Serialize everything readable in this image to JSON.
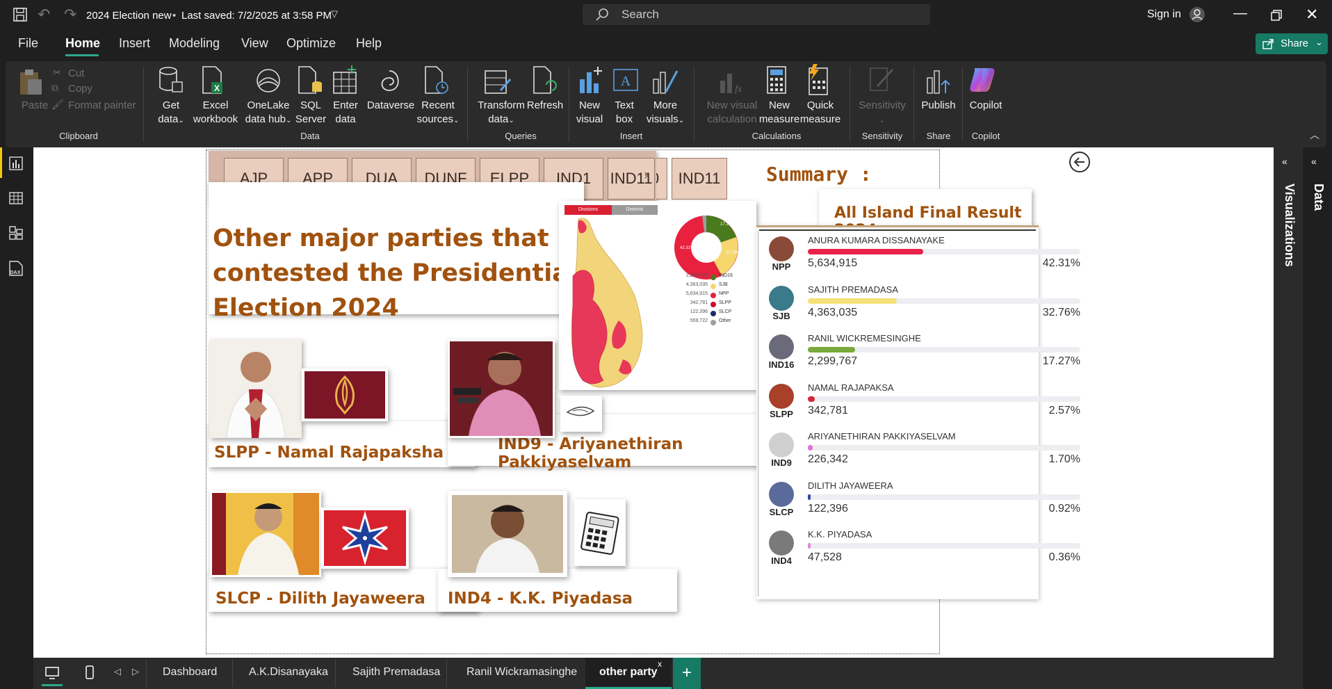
{
  "titlebar": {
    "file_title": "2024 Election new",
    "saved": "Last saved: 7/2/2025 at 3:58 PM",
    "search_placeholder": "Search",
    "signin": "Sign in"
  },
  "menu": [
    "File",
    "Home",
    "Insert",
    "Modeling",
    "View",
    "Optimize",
    "Help"
  ],
  "share_label": "Share",
  "ribbon": {
    "paste": "Paste",
    "cut": "Cut",
    "copy": "Copy",
    "format_painter": "Format painter",
    "get_data": [
      "Get",
      "data"
    ],
    "excel": [
      "Excel",
      "workbook"
    ],
    "onelake": [
      "OneLake",
      "data hub"
    ],
    "sql": [
      "SQL",
      "Server"
    ],
    "enter_data": [
      "Enter",
      "data"
    ],
    "dataverse": "Dataverse",
    "recent": [
      "Recent",
      "sources"
    ],
    "transform": [
      "Transform",
      "data"
    ],
    "refresh": "Refresh",
    "new_visual": [
      "New",
      "visual"
    ],
    "text_box": [
      "Text",
      "box"
    ],
    "more_visuals": [
      "More",
      "visuals"
    ],
    "new_visual_calc": [
      "New visual",
      "calculation"
    ],
    "new_measure": [
      "New",
      "measure"
    ],
    "quick_measure": [
      "Quick",
      "measure"
    ],
    "sensitivity": "Sensitivity",
    "publish": "Publish",
    "copilot": "Copilot",
    "groups": {
      "clipboard": "Clipboard",
      "data": "Data",
      "queries": "Queries",
      "insert": "Insert",
      "calculations": "Calculations",
      "sensitivity": "Sensitivity",
      "share": "Share",
      "copilot": "Copilot"
    }
  },
  "panes": {
    "visualizations": "Visualizations",
    "data": "Data"
  },
  "slicer": [
    "AJP",
    "APP",
    "DUA",
    "DUNF",
    "ELPP",
    "IND1",
    "IND10",
    "IND11"
  ],
  "summary_label": "Summary :",
  "heading": [
    "Other major parties that",
    "contested the Presidential",
    "Election 2024"
  ],
  "map": {
    "toggle": [
      "Divisions",
      "Districts"
    ],
    "donut_labels": [
      "17.27%",
      "32.76%",
      "42.31%"
    ],
    "legend": [
      {
        "votes": "2,299,767",
        "party": "IND16",
        "color": "#4a7a1e"
      },
      {
        "votes": "4,363,035",
        "party": "SJB",
        "color": "#f5d76e"
      },
      {
        "votes": "5,634,915",
        "party": "NPP",
        "color": "#e8213f"
      },
      {
        "votes": "342,781",
        "party": "SLPP",
        "color": "#c8102e"
      },
      {
        "votes": "122,396",
        "party": "SLCP",
        "color": "#1f2a6b"
      },
      {
        "votes": "559,722",
        "party": "Other",
        "color": "#9e9e9e"
      }
    ]
  },
  "captions": {
    "slpp": "SLPP - Namal Rajapaksha",
    "ind9": "IND9 - Ariyanethiran Pakkiyaselvam",
    "slcp": "SLCP - Dilith Jayaweera",
    "ind4": "IND4 - K.K. Piyadasa"
  },
  "result_title": "All Island Final Result 2024",
  "results": [
    {
      "party": "NPP",
      "name": "ANURA KUMARA DISSANAYAKE",
      "votes": "5,634,915",
      "pct": "42.31%",
      "share": 42.31,
      "color": "#e8214a"
    },
    {
      "party": "SJB",
      "name": "SAJITH PREMADASA",
      "votes": "4,363,035",
      "pct": "32.76%",
      "share": 32.76,
      "color": "#f5e07a"
    },
    {
      "party": "IND16",
      "name": "RANIL WICKREMESINGHE",
      "votes": "2,299,767",
      "pct": "17.27%",
      "share": 17.27,
      "color": "#79a83b"
    },
    {
      "party": "SLPP",
      "name": "NAMAL RAJAPAKSA",
      "votes": "342,781",
      "pct": "2.57%",
      "share": 2.57,
      "color": "#d4283a"
    },
    {
      "party": "IND9",
      "name": "ARIYANETHIRAN PAKKIYASELVAM",
      "votes": "226,342",
      "pct": "1.70%",
      "share": 1.7,
      "color": "#e36fd8"
    },
    {
      "party": "SLCP",
      "name": "DILITH JAYAWEERA",
      "votes": "122,396",
      "pct": "0.92%",
      "share": 0.92,
      "color": "#2f4aa8"
    },
    {
      "party": "IND4",
      "name": "K.K. PIYADASA",
      "votes": "47,528",
      "pct": "0.36%",
      "share": 0.36,
      "color": "#e08ad8"
    }
  ],
  "tabs": [
    "Dashboard",
    "A.K.Disanayaka",
    "Sajith Premadasa",
    "Ranil Wickramasinghe",
    "other party"
  ],
  "active_tab": "other party"
}
